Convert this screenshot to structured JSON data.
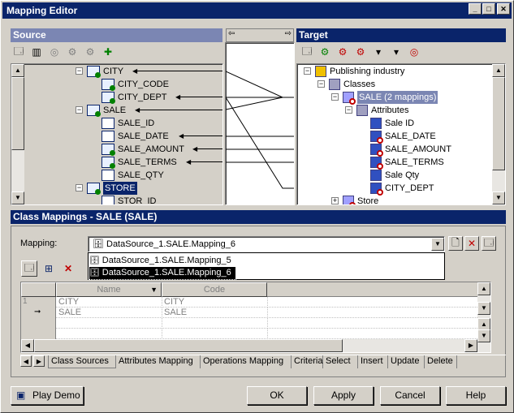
{
  "window": {
    "title": "Mapping Editor"
  },
  "source": {
    "header": "Source",
    "items": [
      "CITY",
      "CITY_CODE",
      "CITY_DEPT",
      "SALE",
      "SALE_ID",
      "SALE_DATE",
      "SALE_AMOUNT",
      "SALE_TERMS",
      "SALE_QTY",
      "STORE",
      "STOR_ID"
    ]
  },
  "target": {
    "header": "Target",
    "items": [
      "Publishing industry",
      "Classes",
      "SALE (2 mappings)",
      "Attributes",
      "Sale ID",
      "SALE_DATE",
      "SALE_AMOUNT",
      "SALE_TERMS",
      "Sale Qty",
      "CITY_DEPT",
      "Store"
    ]
  },
  "class_mappings": {
    "header": "Class Mappings - SALE (SALE)",
    "mapping_label": "Mapping:",
    "mapping_value": "DataSource_1.SALE.Mapping_6",
    "dropdown_options": [
      "DataSource_1.SALE.Mapping_5",
      "DataSource_1.SALE.Mapping_6"
    ],
    "grid": {
      "col_name": "Name",
      "col_code": "Code",
      "rows": [
        {
          "num": "1",
          "marker": "",
          "name": "CITY",
          "code": "CITY"
        },
        {
          "num": "",
          "marker": "➞",
          "name": "SALE",
          "code": "SALE"
        }
      ]
    },
    "tabs": [
      "Class Sources",
      "Attributes Mapping",
      "Operations Mapping",
      "Criteria",
      "Select",
      "Insert",
      "Update",
      "Delete"
    ]
  },
  "buttons": {
    "play_demo": "Play Demo",
    "ok": "OK",
    "apply": "Apply",
    "cancel": "Cancel",
    "help": "Help"
  },
  "colors": {
    "title": "#0a246a",
    "inactive_header": "#7b86b3",
    "face": "#d4d0c8"
  }
}
